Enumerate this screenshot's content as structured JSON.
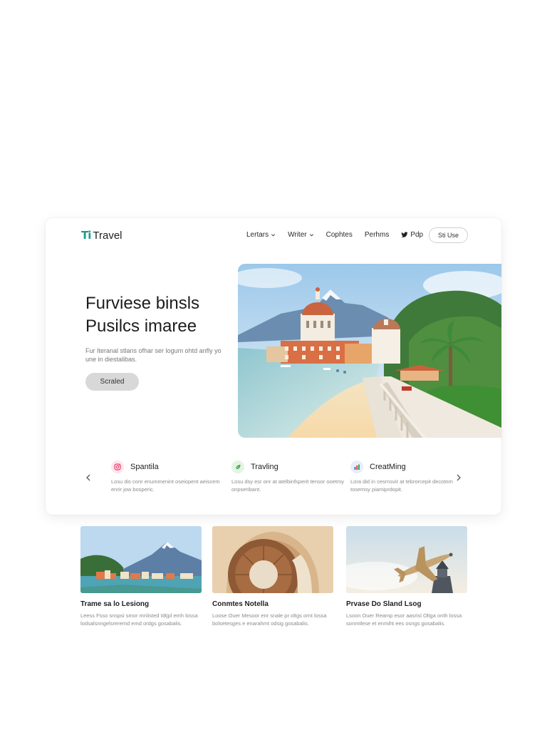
{
  "brand": {
    "mark": "Ti",
    "name": "Travel"
  },
  "nav": {
    "links": [
      {
        "label": "Lertars",
        "has_chevron": true
      },
      {
        "label": "Writer",
        "has_chevron": true
      },
      {
        "label": "Cophtes",
        "has_chevron": false
      },
      {
        "label": "Perhms",
        "has_chevron": false
      },
      {
        "label": "Pdp",
        "has_icon": "bird-icon"
      }
    ],
    "signup": "Sti Use"
  },
  "hero": {
    "title_line1": "Furviese binsls",
    "title_line2": "Pusilcs imaree",
    "subtitle": "Fur Iteranal stlans ofhar ser logum ohtd anfly yo une in diestalibas.",
    "button": "Scraled"
  },
  "features": [
    {
      "title": "Spantila",
      "description": "Losu dis conr enummenint oseiopent aeiscem enrir jow bosperic.",
      "icon": "instagram-icon",
      "color": "#e8406a"
    },
    {
      "title": "Travling",
      "description": "Losu dsy esr onr at atelbinfsperit tensor ooetmy onpseribant.",
      "icon": "leaf-icon",
      "color": "#3ea34a"
    },
    {
      "title": "CreatMing",
      "description": "Lora did in cesrnsvir at tebrorcepit decotnm tosemsy piamiprdopit.",
      "icon": "chart-icon",
      "color": "#3a7bd5"
    }
  ],
  "articles": [
    {
      "title": "Trame sa lo Lesiong",
      "description": "Leess Fsso snspsi smor mnlisted Idtjpl emh lossa lodsalsnngelsreremd emd ordgs gosabalis."
    },
    {
      "title": "Conmtes Notella",
      "description": "Loose Ouer Mesoor enr snale pr oltgs ornt lossa bolsetesges e enarahmt odsig gosabalis."
    },
    {
      "title": "Prvase Do Sland Lsog",
      "description": "Lsoon Ouer Reamp esor aasrisl Oltga onth lossa sonmtlese et enmiht ees osngs gosabalis."
    }
  ]
}
